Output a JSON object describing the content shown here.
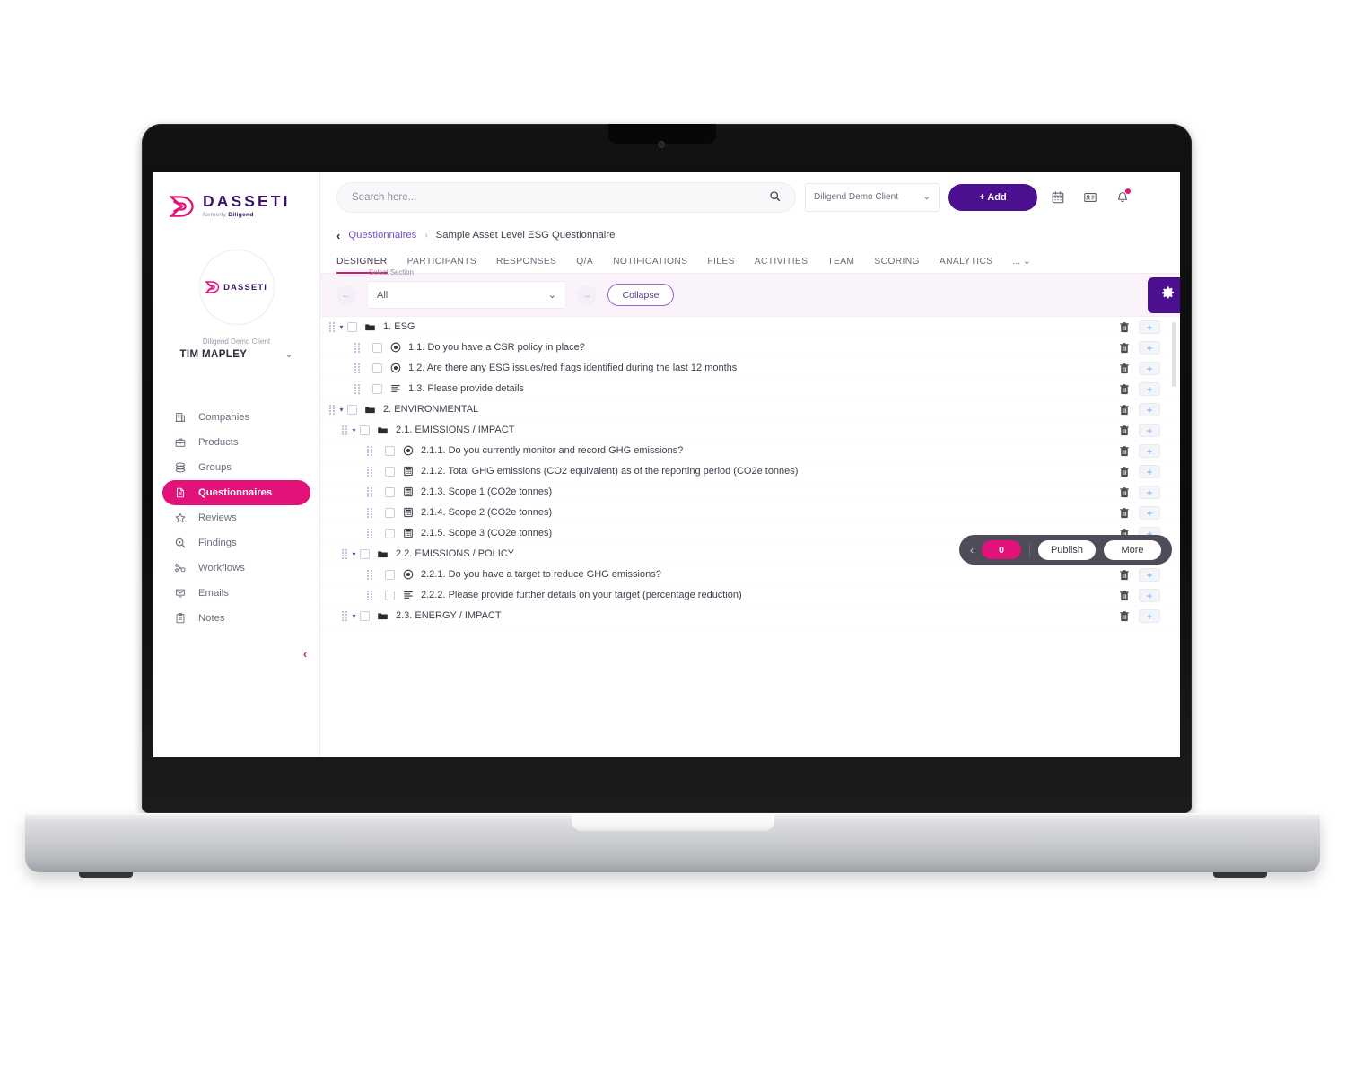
{
  "brand": {
    "logo_name": "DASSETI",
    "logo_sub_prefix": "formerly ",
    "logo_sub_bold": "Diligend",
    "accent_pink": "#e2127a",
    "accent_purple": "#4c0f8f",
    "link_purple": "#7a4fc0"
  },
  "sidebar": {
    "avatar_name": "DASSETI",
    "client_label": "Diligend Demo Client",
    "user_name": "TIM MAPLEY",
    "user_chevron": "⌄",
    "collapse_chevron": "‹",
    "items": [
      {
        "label": "Companies",
        "icon": "building-icon",
        "active": false
      },
      {
        "label": "Products",
        "icon": "briefcase-icon",
        "active": false
      },
      {
        "label": "Groups",
        "icon": "layers-icon",
        "active": false
      },
      {
        "label": "Questionnaires",
        "icon": "document-icon",
        "active": true
      },
      {
        "label": "Reviews",
        "icon": "star-icon",
        "active": false
      },
      {
        "label": "Findings",
        "icon": "search-circle-icon",
        "active": false
      },
      {
        "label": "Workflows",
        "icon": "workflow-icon",
        "active": false
      },
      {
        "label": "Emails",
        "icon": "envelope-icon",
        "active": false
      },
      {
        "label": "Notes",
        "icon": "notes-icon",
        "active": false
      }
    ]
  },
  "topbar": {
    "search_placeholder": "Search here...",
    "search_value": "",
    "search_icon": "search-icon",
    "client_selected": "Diligend Demo Client",
    "client_chevron": "⌄",
    "add_label": "+ Add",
    "icons": [
      "calendar-icon",
      "contact-card-icon",
      "bell-icon"
    ],
    "bell_has_notification": true
  },
  "breadcrumb": {
    "back_icon": "‹",
    "parent": "Questionnaires",
    "separator": "›",
    "current": "Sample Asset Level ESG Questionnaire"
  },
  "tabs": {
    "items": [
      {
        "label": "DESIGNER",
        "active": true
      },
      {
        "label": "PARTICIPANTS",
        "active": false
      },
      {
        "label": "RESPONSES",
        "active": false
      },
      {
        "label": "Q/A",
        "active": false
      },
      {
        "label": "NOTIFICATIONS",
        "active": false
      },
      {
        "label": "FILES",
        "active": false
      },
      {
        "label": "ACTIVITIES",
        "active": false
      },
      {
        "label": "TEAM",
        "active": false
      },
      {
        "label": "SCORING",
        "active": false
      },
      {
        "label": "ANALYTICS",
        "active": false
      }
    ],
    "overflow_label": "... ⌄"
  },
  "toolbar": {
    "prev_arrow": "←",
    "next_arrow": "→",
    "section_field_label": "Select Section",
    "section_selected": "All",
    "section_chevron": "⌄",
    "collapse_label": "Collapse",
    "gear_icon": "gear-icon"
  },
  "tree": {
    "rows": [
      {
        "indent": 0,
        "caret": "▾",
        "type": "folder",
        "label": "1. ESG"
      },
      {
        "indent": 1,
        "caret": "",
        "type": "radio",
        "label": "1.1. Do you have a CSR policy in place?"
      },
      {
        "indent": 1,
        "caret": "",
        "type": "radio",
        "label": "1.2. Are there any ESG issues/red flags identified during the last 12 months"
      },
      {
        "indent": 1,
        "caret": "",
        "type": "text",
        "label": "1.3. Please provide details"
      },
      {
        "indent": 0,
        "caret": "▾",
        "type": "folder",
        "label": "2. ENVIRONMENTAL"
      },
      {
        "indent": 1,
        "caret": "▾",
        "type": "folder",
        "label": "2.1. EMISSIONS / IMPACT"
      },
      {
        "indent": 2,
        "caret": "",
        "type": "radio",
        "label": "2.1.1. Do you currently monitor and record GHG emissions?"
      },
      {
        "indent": 2,
        "caret": "",
        "type": "number",
        "label": "2.1.2. Total GHG emissions (CO2 equivalent) as of the reporting period (CO2e tonnes)"
      },
      {
        "indent": 2,
        "caret": "",
        "type": "number",
        "label": "2.1.3. Scope 1 (CO2e tonnes)"
      },
      {
        "indent": 2,
        "caret": "",
        "type": "number",
        "label": "2.1.4. Scope 2 (CO2e tonnes)"
      },
      {
        "indent": 2,
        "caret": "",
        "type": "number",
        "label": "2.1.5. Scope 3 (CO2e tonnes)"
      },
      {
        "indent": 1,
        "caret": "▾",
        "type": "folder",
        "label": "2.2. EMISSIONS / POLICY"
      },
      {
        "indent": 2,
        "caret": "",
        "type": "radio",
        "label": "2.2.1. Do you have a target to reduce GHG emissions?"
      },
      {
        "indent": 2,
        "caret": "",
        "type": "text",
        "label": "2.2.2. Please provide further details on your target (percentage reduction)"
      },
      {
        "indent": 1,
        "caret": "▾",
        "type": "folder",
        "label": "2.3. ENERGY / IMPACT"
      }
    ],
    "row_delete_icon": "trash-icon",
    "row_add_icon": "plus-icon"
  },
  "action_bar": {
    "prev_chevron": "‹",
    "count": "0",
    "publish_label": "Publish",
    "more_label": "More",
    "badge_label": "!"
  }
}
